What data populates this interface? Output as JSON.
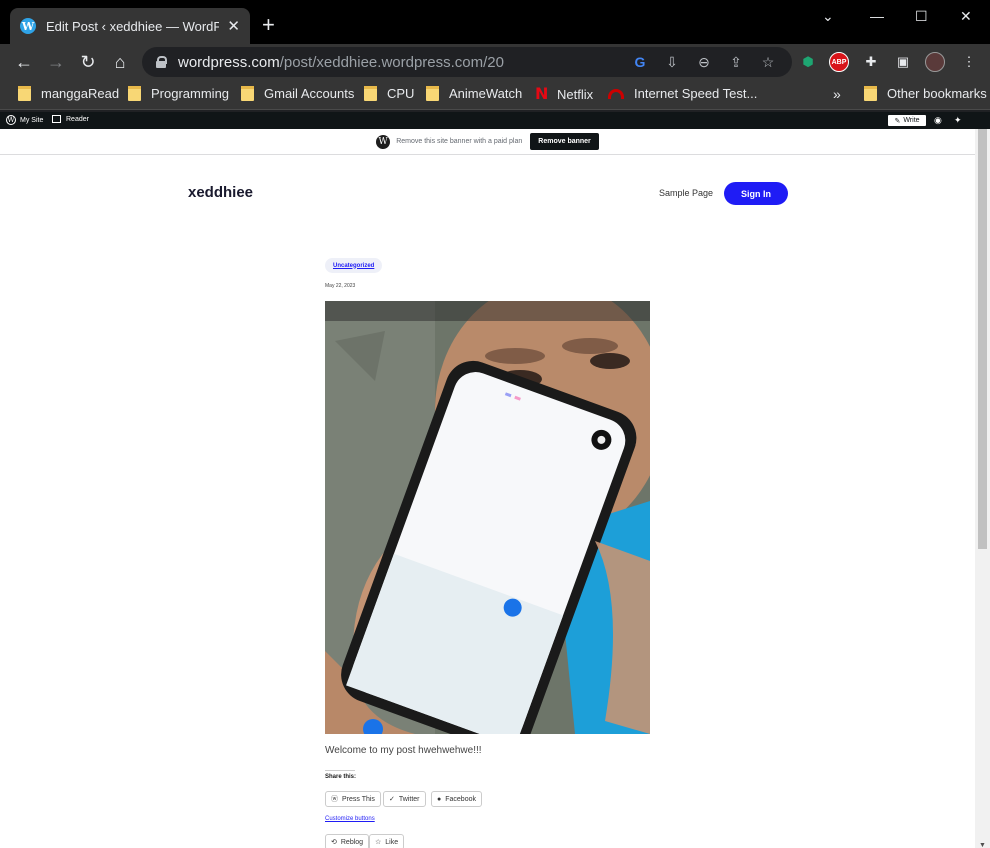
{
  "browser": {
    "tab_title": "Edit Post ‹ xeddhiee — WordPress",
    "url_host": "wordpress.com",
    "url_path": "/post/xeddhiee.wordpress.com/20",
    "bookmarks": [
      "manggaRead",
      "Programming",
      "Gmail Accounts",
      "CPU",
      "AnimeWatch",
      "Netflix",
      "Internet Speed Test...",
      "Other bookmarks"
    ],
    "overflow_label": "»",
    "abp_label": "ABP"
  },
  "wp_bar": {
    "my_site": "My Site",
    "reader": "Reader",
    "write": "Write"
  },
  "banner": {
    "text": "Remove this site banner with a paid plan",
    "button": "Remove banner"
  },
  "site": {
    "title": "xeddhiee",
    "nav_link": "Sample Page",
    "sign_in": "Sign In"
  },
  "post": {
    "category": "Uncategorized",
    "date": "May 22, 2023",
    "body": "Welcome to my post hwehwehwe!!!",
    "share_label": "Share this:",
    "share_buttons": [
      "Press This",
      "Twitter",
      "Facebook"
    ],
    "customize": "Customize buttons",
    "reblog": "Reblog",
    "like": "Like"
  }
}
